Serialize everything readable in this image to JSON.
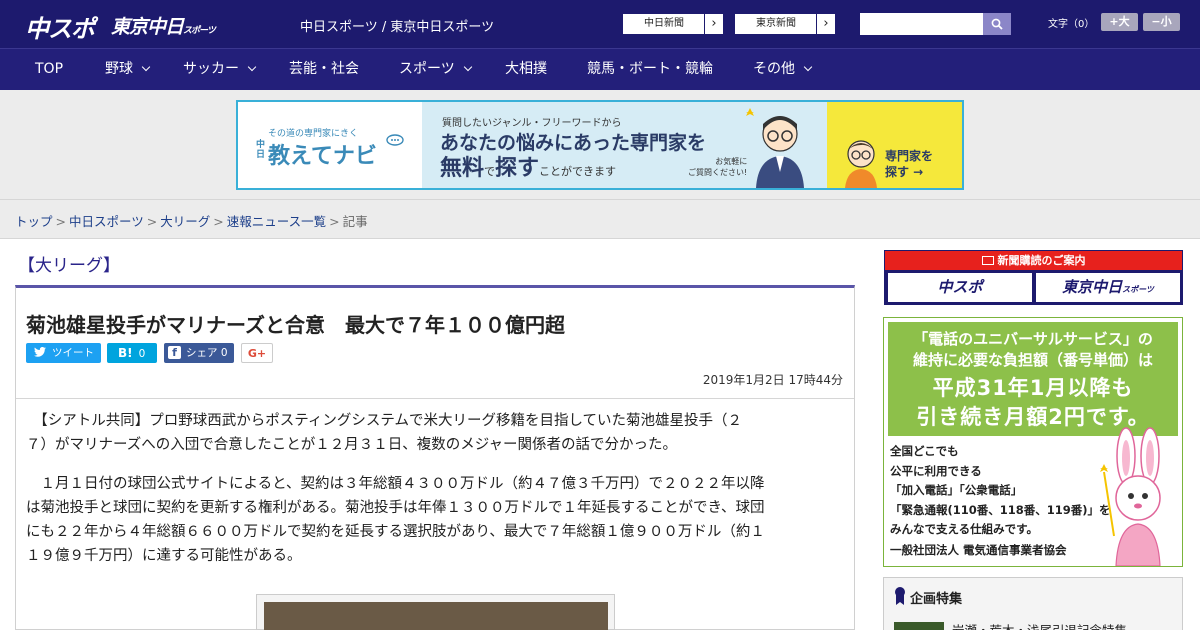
{
  "header": {
    "logo_chuspo": "中スポ",
    "logo_tokyo": "東京中日",
    "logo_tokyo_suffix": "スポーツ",
    "site_names": "中日スポーツ / 東京中日スポーツ",
    "newspaper_links": [
      "中日新聞",
      "東京新聞"
    ],
    "search_placeholder": "",
    "fontsize_label": "文字（0）",
    "fontsize_up": "+大",
    "fontsize_down": "−小"
  },
  "nav": {
    "items": [
      {
        "label": "TOP",
        "dropdown": false
      },
      {
        "label": "野球",
        "dropdown": true
      },
      {
        "label": "サッカー",
        "dropdown": true
      },
      {
        "label": "芸能・社会",
        "dropdown": false
      },
      {
        "label": "スポーツ",
        "dropdown": true
      },
      {
        "label": "大相撲",
        "dropdown": false
      },
      {
        "label": "競馬・ボート・競輪",
        "dropdown": false
      },
      {
        "label": "その他",
        "dropdown": true
      }
    ]
  },
  "ad_banner": {
    "tagline": "その道の専門家にきく",
    "brand_prefix": "中日",
    "brand": "教えてナビ",
    "question": "質問したいジャンル・フリーワードから",
    "headline1": "あなたの悩みにあった専門家を",
    "headline2_a": "無料",
    "headline2_b": "で",
    "headline2_c": "探す",
    "headline2_d": "ことができます",
    "note1": "お気軽に",
    "note2": "ご質問ください!",
    "cta1": "専門家を",
    "cta2": "探す →"
  },
  "breadcrumb": {
    "items": [
      "トップ",
      "中日スポーツ",
      "大リーグ",
      "速報ニュース一覧"
    ],
    "current": "記事"
  },
  "article": {
    "category": "【大リーグ】",
    "title": "菊池雄星投手がマリナーズと合意　最大で７年１００億円超",
    "share": {
      "tweet": "ツイート",
      "hatena_icon": "B!",
      "hatena_count": "0",
      "facebook_icon": "f",
      "facebook_label": "シェア",
      "facebook_count": "0",
      "gplus": "G+"
    },
    "date": "2019年1月2日 17時44分",
    "paragraphs": [
      [
        "　【シアトル共同】プロ野球西武からポスティングシステムで米大リーグ移籍を目指していた菊池雄星投手（２",
        "７）がマリナーズへの入団で合意したことが１２月３１日、複数のメジャー関係者の話で分かった。"
      ],
      [
        "　１月１日付の球団公式サイトによると、契約は３年総額４３００万ドル（約４７億３千万円）で２０２２年以降",
        "は菊池投手と球団に契約を更新する権利がある。菊池投手は年俸１３００万ドルで１年延長することができ、球団",
        "にも２２年から４年総額６６００万ドルで契約を延長する選択肢があり、最大で７年総額１億９００万ドル（約１",
        "１９億９千万円）に達する可能性がある。"
      ]
    ]
  },
  "sidebar": {
    "subscribe_head": "新聞購読のご案内",
    "subscribe_logos": [
      "中スポ",
      "東京中日"
    ],
    "subscribe_logo_suffix": "スポーツ",
    "ad": {
      "line1": "「電話のユニバーサルサービス」の",
      "line2": "維持に必要な負担額（番号単価）は",
      "big1": "平成31年1月以降も",
      "big2": "引き続き月額2円です。",
      "body": [
        "全国どこでも",
        "公平に利用できる",
        "「加入電話」「公衆電話」",
        "「緊急通報(110番、118番、119番)」を",
        "みんなで支える仕組みです。"
      ],
      "org": "一般社団法人 電気通信事業者協会"
    },
    "feature_title": "企画特集",
    "feature_item": "岩瀬・荒木・浅尾引退記念特集"
  },
  "colors": {
    "header_bg": "#1d1a6e",
    "nav_bg": "#231f7a",
    "accent_red": "#e7211d",
    "twitter": "#1da1f2",
    "hatena": "#00a4de",
    "facebook": "#3b5998",
    "ad_green": "#8dc04a"
  }
}
